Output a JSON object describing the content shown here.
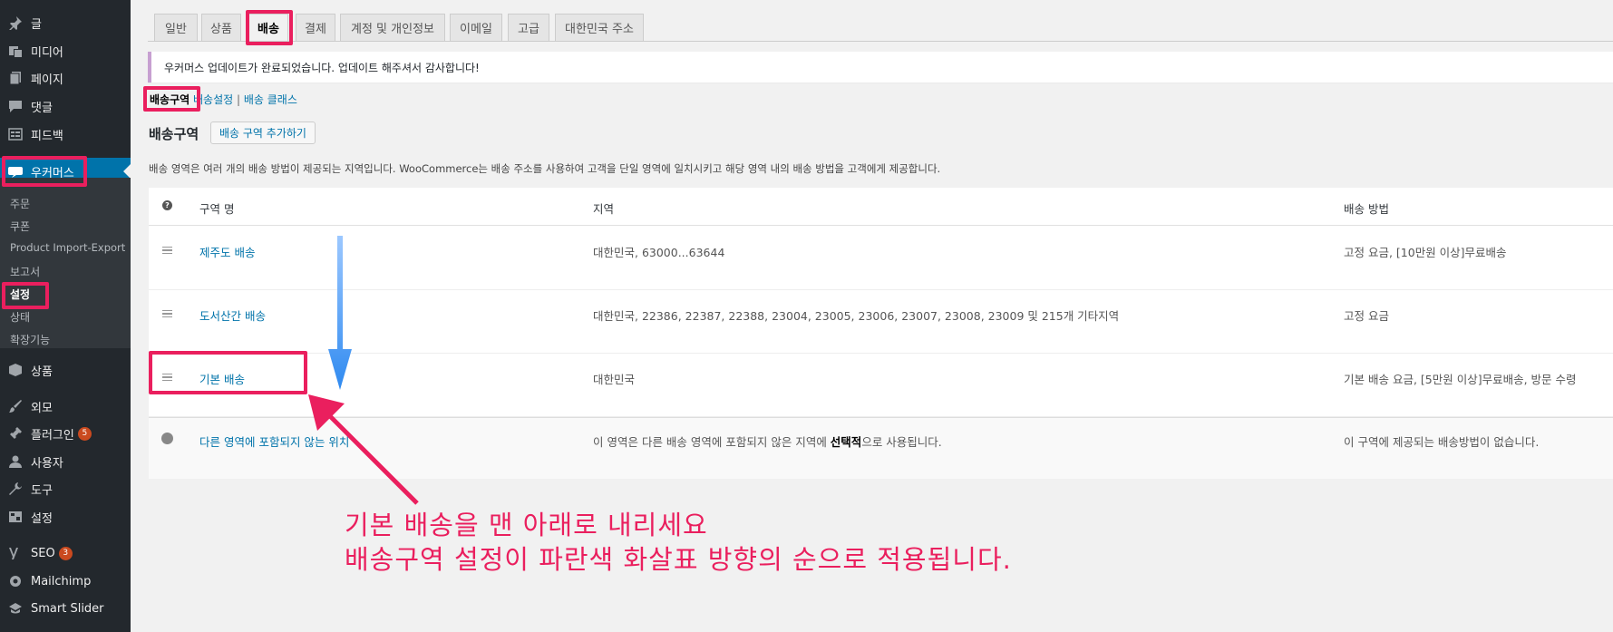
{
  "sidebar": {
    "items": [
      {
        "label": "글",
        "icon": "pin-icon"
      },
      {
        "label": "미디어",
        "icon": "media-icon"
      },
      {
        "label": "페이지",
        "icon": "page-icon"
      },
      {
        "label": "댓글",
        "icon": "comment-icon"
      },
      {
        "label": "피드백",
        "icon": "feedback-icon"
      },
      {
        "label": "우커머스",
        "icon": "woocommerce-icon"
      }
    ],
    "woo_submenu": [
      "주문",
      "쿠폰",
      "Product Import-Export",
      "보고서",
      "설정",
      "상태",
      "확장기능"
    ],
    "lower_items": [
      {
        "label": "상품",
        "icon": "product-icon"
      },
      {
        "label": "외모",
        "icon": "brush-icon"
      },
      {
        "label": "플러그인",
        "icon": "plugin-icon",
        "badge": "5"
      },
      {
        "label": "사용자",
        "icon": "user-icon"
      },
      {
        "label": "도구",
        "icon": "wrench-icon"
      },
      {
        "label": "설정",
        "icon": "settings-icon"
      },
      {
        "label": "SEO",
        "icon": "yoast-icon",
        "badge": "3"
      },
      {
        "label": "Mailchimp",
        "icon": "mailchimp-icon"
      },
      {
        "label": "Smart Slider",
        "icon": "slider-icon"
      }
    ]
  },
  "tabs": [
    "일반",
    "상품",
    "배송",
    "결제",
    "계정 및 개인정보",
    "이메일",
    "고급",
    "대한민국 주소"
  ],
  "notice": "우커머스 업데이트가 완료되었습니다. 업데이트 해주셔서 감사합니다!",
  "subnav": {
    "current": "배송구역",
    "link1": "배송설정",
    "sep": "|",
    "link2": "배송 클래스"
  },
  "heading": "배송구역",
  "add_zone_label": "배송 구역 추가하기",
  "description": "배송 영역은 여러 개의 배송 방법이 제공되는 지역입니다. WooCommerce는 배송 주소를 사용하여 고객을 단일 영역에 일치시키고 해당 영역 내의 배송 방법을 고객에게 제공합니다.",
  "table": {
    "headers": {
      "help": "?",
      "name": "구역 명",
      "region": "지역",
      "methods": "배송 방법"
    },
    "rows": [
      {
        "name": "제주도 배송",
        "region": "대한민국, 63000...63644",
        "methods": "고정 요금, [10만원 이상]무료배송"
      },
      {
        "name": "도서산간 배송",
        "region": "대한민국, 22386, 22387, 22388, 23004, 23005, 23006, 23007, 23008, 23009 및 215개 기타지역",
        "methods": "고정 요금"
      },
      {
        "name": "기본 배송",
        "region": "대한민국",
        "methods": "기본 배송 요금, [5만원 이상]무료배송, 방문 수령"
      }
    ],
    "other": {
      "name": "다른 영역에 포함되지 않는 위치",
      "region_pre": "이 영역은 다른 배송 영역에 포함되지 않은 지역에 ",
      "region_bold": "선택적",
      "region_post": "으로 사용됩니다.",
      "methods": "이 구역에 제공되는 배송방법이 없습니다."
    }
  },
  "annotation": {
    "line1": "기본 배송을 맨 아래로 내리세요",
    "line2": "배송구역 설정이 파란색 화살표 방향의 순으로 적용됩니다."
  },
  "colors": {
    "highlight": "#ea1f5e",
    "arrow_blue": "#2f8af0",
    "wp_blue": "#0073aa",
    "sidebar": "#23282d"
  }
}
